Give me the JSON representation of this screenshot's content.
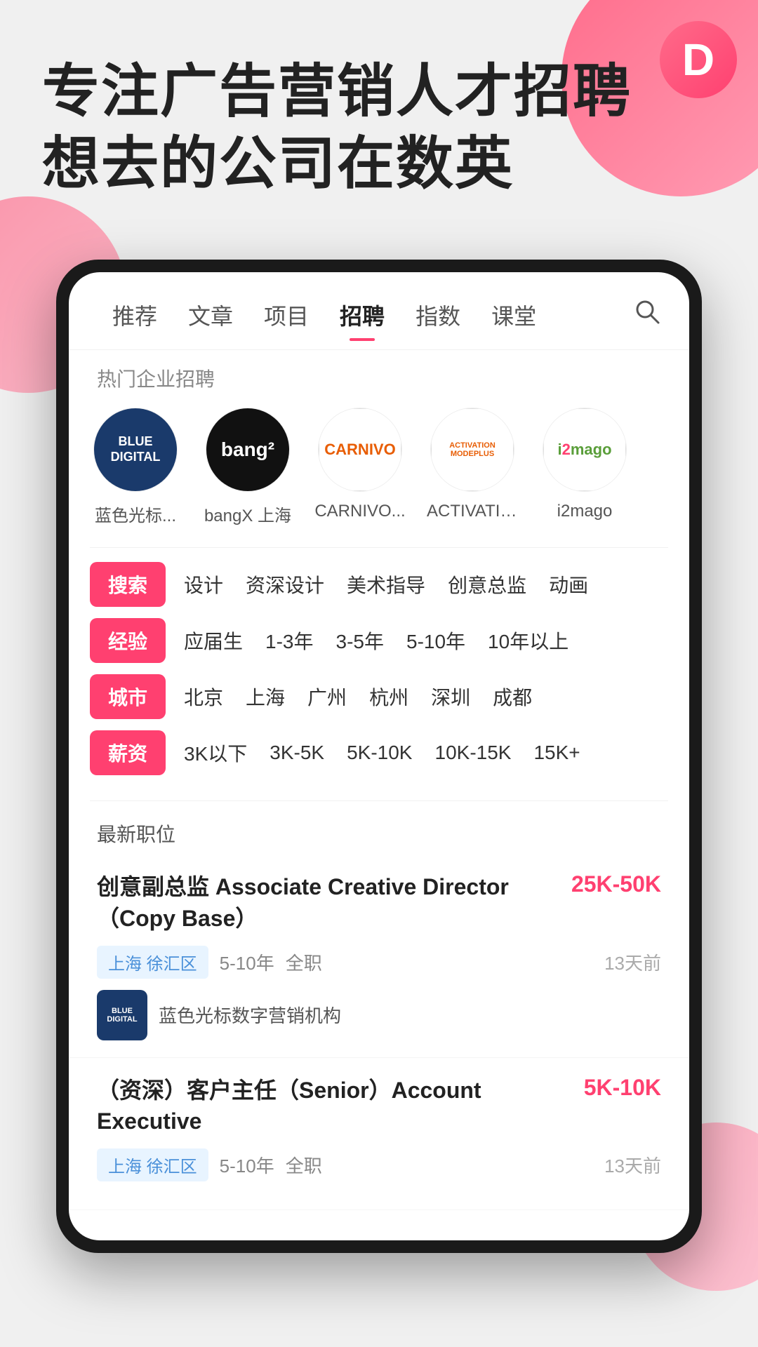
{
  "app": {
    "logo_letter": "D"
  },
  "hero": {
    "line1": "专注广告营销人才招聘",
    "line2": "想去的公司在数英"
  },
  "nav": {
    "items": [
      {
        "label": "推荐",
        "active": false
      },
      {
        "label": "文章",
        "active": false
      },
      {
        "label": "项目",
        "active": false
      },
      {
        "label": "招聘",
        "active": true
      },
      {
        "label": "指数",
        "active": false
      },
      {
        "label": "课堂",
        "active": false
      }
    ],
    "search_icon": "🔍"
  },
  "companies": {
    "section_label": "热门企业招聘",
    "items": [
      {
        "name": "蓝色光标...",
        "logo_type": "blue_digital",
        "logo_text": "BLUE\nDIGITAL"
      },
      {
        "name": "bangX 上海",
        "logo_type": "bangx",
        "logo_text": "bang²"
      },
      {
        "name": "CARNIVO...",
        "logo_type": "carnivo",
        "logo_text": "CARNIVO"
      },
      {
        "name": "ACTIVATIO...",
        "logo_type": "activation",
        "logo_text": "ACTIVATION MODEPLUS"
      },
      {
        "name": "i2mago",
        "logo_type": "i2mago",
        "logo_text": "imago"
      }
    ]
  },
  "filters": {
    "rows": [
      {
        "tag": "搜索",
        "items": [
          "设计",
          "资深设计",
          "美术指导",
          "创意总监",
          "动画"
        ]
      },
      {
        "tag": "经验",
        "items": [
          "应届生",
          "1-3年",
          "3-5年",
          "5-10年",
          "10年以上"
        ]
      },
      {
        "tag": "城市",
        "items": [
          "北京",
          "上海",
          "广州",
          "杭州",
          "深圳",
          "成都"
        ]
      },
      {
        "tag": "薪资",
        "items": [
          "3K以下",
          "3K-5K",
          "5K-10K",
          "10K-15K",
          "15K+"
        ]
      }
    ]
  },
  "jobs": {
    "section_label": "最新职位",
    "items": [
      {
        "title": "创意副总监 Associate Creative Director（Copy Base）",
        "salary": "25K-50K",
        "location": "上海 徐汇区",
        "experience": "5-10年",
        "job_type": "全职",
        "posted": "13天前",
        "company_name": "蓝色光标数字营销机构",
        "company_logo_text": "BLUE\nDIGITAL"
      },
      {
        "title": "（资深）客户主任（Senior）Account Executive",
        "salary": "5K-10K",
        "location": "上海 徐汇区",
        "experience": "5-10年",
        "job_type": "全职",
        "posted": "13天前",
        "company_name": "",
        "company_logo_text": ""
      }
    ]
  }
}
